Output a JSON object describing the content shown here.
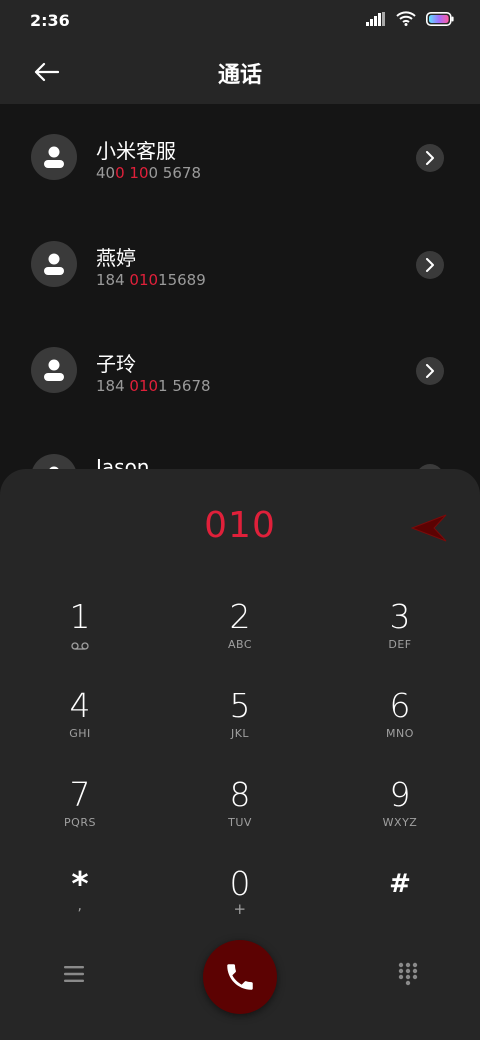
{
  "status": {
    "time": "2:36"
  },
  "header": {
    "title": "通话"
  },
  "contacts": [
    {
      "name": "小米客服",
      "number_parts": [
        "40",
        "0 10",
        "0 5678"
      ]
    },
    {
      "name": "燕婷",
      "number_parts": [
        "184 ",
        "010",
        "15689"
      ]
    },
    {
      "name": "子玲",
      "number_parts": [
        "184 ",
        "010",
        "1 5678"
      ]
    },
    {
      "name": "Jason",
      "number_parts": [
        "",
        "",
        ""
      ]
    }
  ],
  "dialer": {
    "entered": "010",
    "keys": [
      {
        "num": "1",
        "sub": ""
      },
      {
        "num": "2",
        "sub": "ABC"
      },
      {
        "num": "3",
        "sub": "DEF"
      },
      {
        "num": "4",
        "sub": "GHI"
      },
      {
        "num": "5",
        "sub": "JKL"
      },
      {
        "num": "6",
        "sub": "MNO"
      },
      {
        "num": "7",
        "sub": "PQRS"
      },
      {
        "num": "8",
        "sub": "TUV"
      },
      {
        "num": "9",
        "sub": "WXYZ"
      },
      {
        "num": "*",
        "sub": ","
      },
      {
        "num": "0",
        "sub": "+"
      },
      {
        "num": "#",
        "sub": ""
      }
    ]
  },
  "colors": {
    "accent": "#e0203a",
    "call": "#5c0202",
    "surface": "#262626",
    "background": "#151515"
  }
}
